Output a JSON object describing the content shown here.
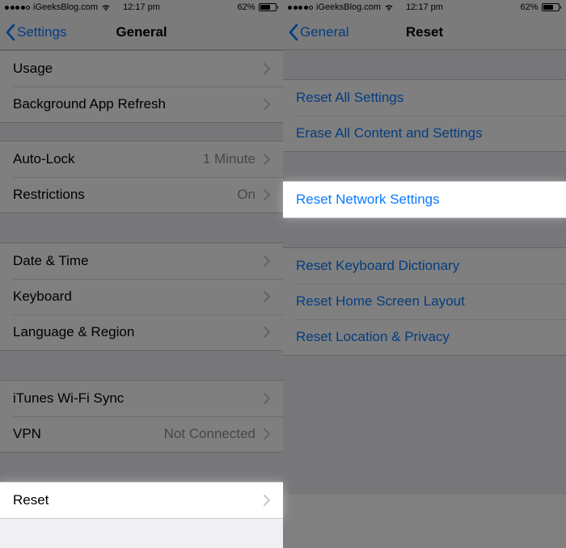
{
  "status": {
    "carrier": "iGeeksBlog.com",
    "time": "12:17 pm",
    "battery_pct": "62%"
  },
  "left": {
    "nav_back": "Settings",
    "nav_title": "General",
    "rows": {
      "usage": "Usage",
      "background_refresh": "Background App Refresh",
      "auto_lock": "Auto-Lock",
      "auto_lock_value": "1 Minute",
      "restrictions": "Restrictions",
      "restrictions_value": "On",
      "date_time": "Date & Time",
      "keyboard": "Keyboard",
      "language_region": "Language & Region",
      "itunes_wifi": "iTunes Wi-Fi Sync",
      "vpn": "VPN",
      "vpn_value": "Not Connected",
      "reset": "Reset"
    }
  },
  "right": {
    "nav_back": "General",
    "nav_title": "Reset",
    "rows": {
      "reset_all": "Reset All Settings",
      "erase_all": "Erase All Content and Settings",
      "reset_network": "Reset Network Settings",
      "reset_keyboard": "Reset Keyboard Dictionary",
      "reset_home": "Reset Home Screen Layout",
      "reset_loc": "Reset Location & Privacy"
    }
  }
}
